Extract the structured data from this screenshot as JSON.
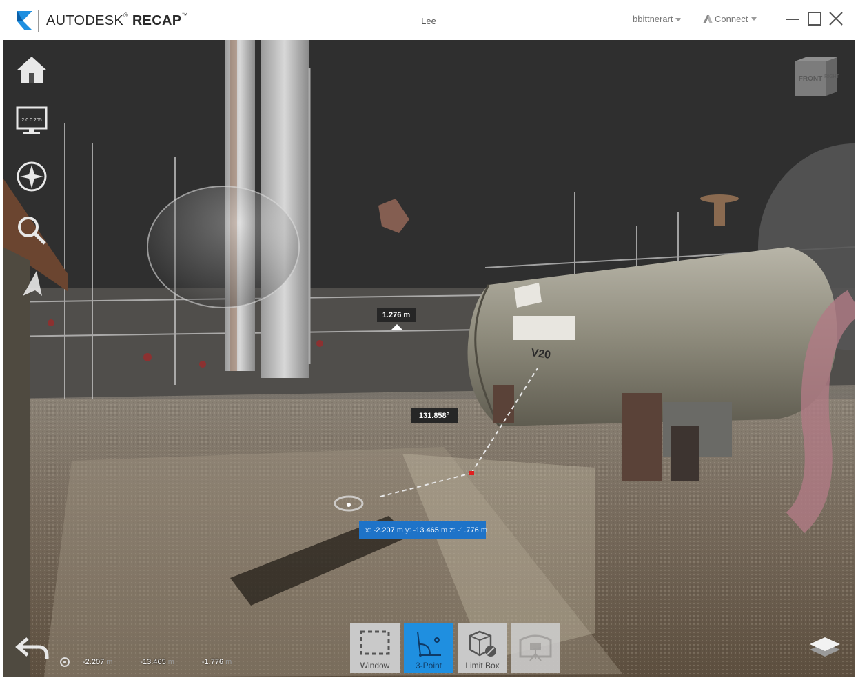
{
  "app": {
    "brand_light": "AUTODESK",
    "brand_bold": "RECAP",
    "trademark": "®",
    "tm": "™",
    "project_title": "Lee",
    "user": "bbittnerart",
    "connect": "Connect"
  },
  "viewport": {
    "monitor_badge": "2.0.0.205",
    "viewcube": {
      "front": "FRONT",
      "right": "RIGHT"
    },
    "scene_text": {
      "tank_label": "V20"
    },
    "measurements": {
      "length": "1.276 m",
      "angle": "131.858°"
    },
    "point_popup": {
      "x_label": "x:",
      "x_value": "-2.207",
      "x_unit": "m",
      "y_label": "y:",
      "y_value": "-13.465",
      "y_unit": "m",
      "z_label": "z:",
      "z_value": "-1.776",
      "z_unit": "m"
    }
  },
  "toolbar": {
    "window": "Window",
    "three_point": "3-Point",
    "limit_box": "Limit Box"
  },
  "status": {
    "x": "-2.207",
    "x_unit": "m",
    "y": "-13.465",
    "y_unit": "m",
    "z": "-1.776",
    "z_unit": "m"
  },
  "colors": {
    "accent": "#1f8fe0",
    "coord_popup": "#1e73c8",
    "sky": "#2f2f2f",
    "logo": "#1f8fe0"
  },
  "icons": {
    "home": "home-icon",
    "monitor": "monitor-icon",
    "compass": "compass-icon",
    "search": "search-icon",
    "navigate": "navigate-arrow-icon",
    "back": "back-arrow-icon",
    "layers": "layers-icon"
  }
}
